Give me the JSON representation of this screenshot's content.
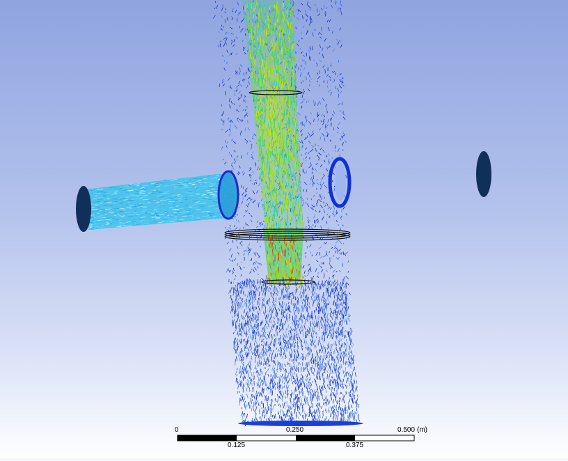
{
  "scale_bar": {
    "top_labels": [
      "0",
      "0.250",
      "0.500"
    ],
    "unit": "(m)",
    "bottom_labels": [
      "0.125",
      "0.375"
    ]
  },
  "colors": {
    "background_top": "#8fa4e0",
    "background_bottom": "#ffffff",
    "low_velocity": "#1a3fd6",
    "mid_velocity": "#22c6e8",
    "high_velocity": "#8ee000",
    "peak_velocity": "#e03a1a",
    "inlet_disc": "#0e2a55"
  }
}
